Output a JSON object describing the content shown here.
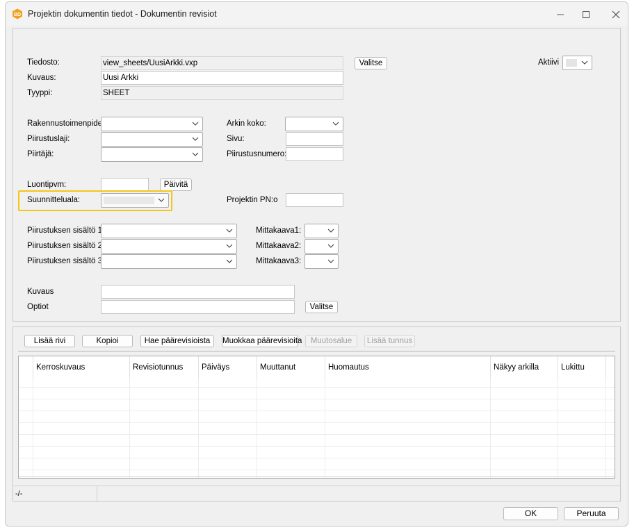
{
  "window": {
    "title": "Projektin dokumentin tiedot - Dokumentin revisiot",
    "app_icon_text": "BD"
  },
  "form": {
    "tiedosto_label": "Tiedosto:",
    "tiedosto_value": "view_sheets/UusiArkki.vxp",
    "valitse_label": "Valitse",
    "kuvaus_label": "Kuvaus:",
    "kuvaus_value": "Uusi Arkki",
    "tyyppi_label": "Tyyppi:",
    "tyyppi_value": "SHEET",
    "aktiivi_label": "Aktiivi",
    "rakennustoimenpide_label": "Rakennustoimenpide:",
    "piirustuslaji_label": "Piirustuslaji:",
    "piirtaja_label": "Piirtäjä:",
    "arkin_koko_label": "Arkin koko:",
    "sivu_label": "Sivu:",
    "piirustusnumero_label": "Piirustusnumero:",
    "luontipvm_label": "Luontipvm:",
    "paivita_label": "Päivitä",
    "suunnitteluala_label": "Suunnitteluala:",
    "projektin_pn_label": "Projektin PN:o",
    "sisalto1_label": "Piirustuksen sisältö 1:",
    "sisalto2_label": "Piirustuksen sisältö 2:",
    "sisalto3_label": "Piirustuksen sisältö 3:",
    "mittakaava1_label": "Mittakaava1:",
    "mittakaava2_label": "Mittakaava2:",
    "mittakaava3_label": "Mittakaava3:",
    "kuvaus2_label": "Kuvaus",
    "optiot_label": "Optiot",
    "valitse2_label": "Valitse",
    "highlight_color": "#f5c518"
  },
  "revisions": {
    "toolbar": {
      "lisaa_rivi": "Lisää rivi",
      "kopioi": "Kopioi",
      "hae": "Hae päärevisioista",
      "muokkaa": "Muokkaa päärevisioita",
      "muutosalue": "Muutosalue",
      "lisaa_tunnus": "Lisää tunnus"
    },
    "columns": [
      "Kerroskuvaus",
      "Revisiotunnus",
      "Päiväys",
      "Muuttanut",
      "Huomautus",
      "Näkyy arkilla",
      "Lukittu"
    ],
    "rows": []
  },
  "status": {
    "text": "-/-"
  },
  "footer": {
    "ok": "OK",
    "cancel": "Peruuta"
  }
}
